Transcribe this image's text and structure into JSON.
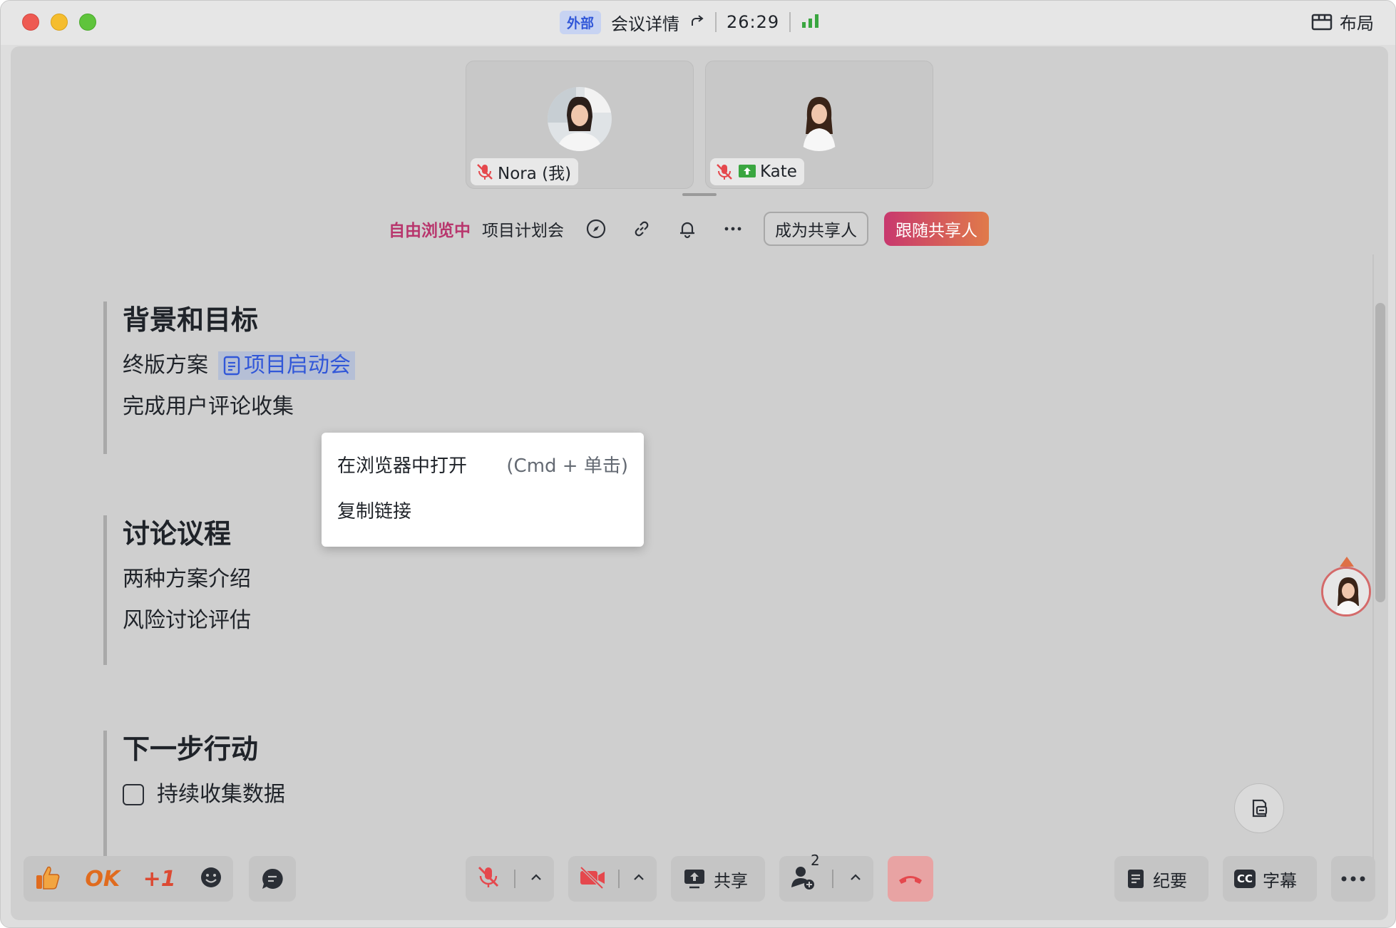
{
  "titlebar": {
    "external_badge": "外部",
    "meeting_details": "会议详情",
    "timer": "26:29",
    "layout_label": "布局"
  },
  "participants": [
    {
      "name": "Nora (我)",
      "muted": true,
      "sharing": false
    },
    {
      "name": "Kate",
      "muted": true,
      "sharing": true
    }
  ],
  "share_bar": {
    "mode_label": "自由浏览中",
    "doc_title": "项目计划会",
    "become_sharer": "成为共享人",
    "follow_sharer": "跟随共享人"
  },
  "document": {
    "sections": [
      {
        "heading": "背景和目标",
        "lines": [
          "终版方案",
          "完成用户评论收集"
        ],
        "mention": "项目启动会"
      },
      {
        "heading": "讨论议程",
        "lines": [
          "两种方案介绍",
          "风险讨论评估"
        ]
      },
      {
        "heading": "下一步行动",
        "tasks": [
          {
            "label": "持续收集数据",
            "checked": false
          }
        ]
      }
    ]
  },
  "context_menu": {
    "items": [
      {
        "label": "在浏览器中打开",
        "hint": "(Cmd + 单击)"
      },
      {
        "label": "复制链接",
        "hint": ""
      }
    ]
  },
  "bottom_bar": {
    "reaction_ok": "OK",
    "reaction_plus_one": "+1",
    "share_label": "共享",
    "participants_count": "2",
    "notes_label": "纪要",
    "captions_label": "字幕",
    "captions_icon_text": "CC"
  },
  "colors": {
    "accent_blue": "#3157d8",
    "free_browse_pink": "#b8366d",
    "follow_gradient_start": "#c8386e",
    "follow_gradient_end": "#e07a4a",
    "end_call_red": "#e8a3a3",
    "mute_red": "#e5484d",
    "signal_green": "#3aa640"
  }
}
